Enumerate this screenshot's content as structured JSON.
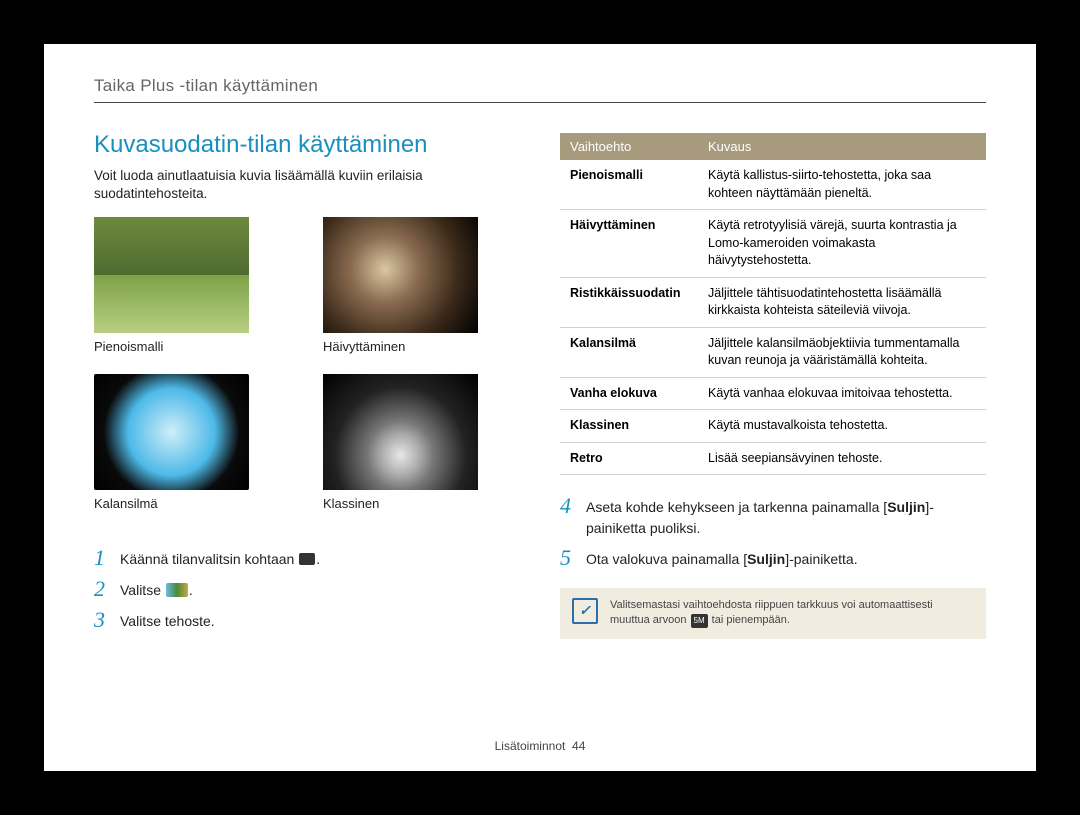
{
  "header": {
    "title": "Taika Plus -tilan käyttäminen"
  },
  "left": {
    "section_title": "Kuvasuodatin-tilan käyttäminen",
    "intro": "Voit luoda ainutlaatuisia kuvia lisäämällä kuviin erilaisia suodatintehosteita.",
    "thumbs": [
      {
        "label": "Pienoismalli"
      },
      {
        "label": "Häivyttäminen"
      },
      {
        "label": "Kalansilmä"
      },
      {
        "label": "Klassinen"
      }
    ],
    "steps": [
      {
        "n": "1",
        "text_before": "Käännä tilanvalitsin kohtaan ",
        "text_after": "."
      },
      {
        "n": "2",
        "text_before": "Valitse ",
        "text_after": "."
      },
      {
        "n": "3",
        "text": "Valitse tehoste."
      }
    ]
  },
  "right": {
    "table_headers": {
      "col1": "Vaihtoehto",
      "col2": "Kuvaus"
    },
    "rows": [
      {
        "name": "Pienoismalli",
        "desc": "Käytä kallistus-siirto-tehostetta, joka saa kohteen näyttämään pieneltä."
      },
      {
        "name": "Häivyttäminen",
        "desc": "Käytä retrotyylisiä värejä, suurta kontrastia ja Lomo-kameroiden voimakasta häivytystehostetta."
      },
      {
        "name": "Ristikkäissuodatin",
        "desc": "Jäljittele tähtisuodatintehostetta lisäämällä kirkkaista kohteista säteileviä viivoja."
      },
      {
        "name": "Kalansilmä",
        "desc": "Jäljittele kalansilmäobjektiivia tummentamalla kuvan reunoja ja vääristämällä kohteita."
      },
      {
        "name": "Vanha elokuva",
        "desc": "Käytä vanhaa elokuvaa imitoivaa tehostetta."
      },
      {
        "name": "Klassinen",
        "desc": "Käytä mustavalkoista tehostetta."
      },
      {
        "name": "Retro",
        "desc": "Lisää seepiansävyinen tehoste."
      }
    ],
    "steps": [
      {
        "n": "4",
        "prefix": "Aseta kohde kehykseen ja tarkenna painamalla [",
        "bold": "Suljin",
        "suffix": "]-painiketta puoliksi."
      },
      {
        "n": "5",
        "prefix": "Ota valokuva painamalla [",
        "bold": "Suljin",
        "suffix": "]-painiketta."
      }
    ],
    "note": {
      "text_before": "Valitsemastasi vaihtoehdosta riippuen tarkkuus voi automaattisesti muuttua arvoon ",
      "badge": "5M",
      "text_after": " tai pienempään."
    }
  },
  "footer": {
    "label": "Lisätoiminnot",
    "page": "44"
  }
}
